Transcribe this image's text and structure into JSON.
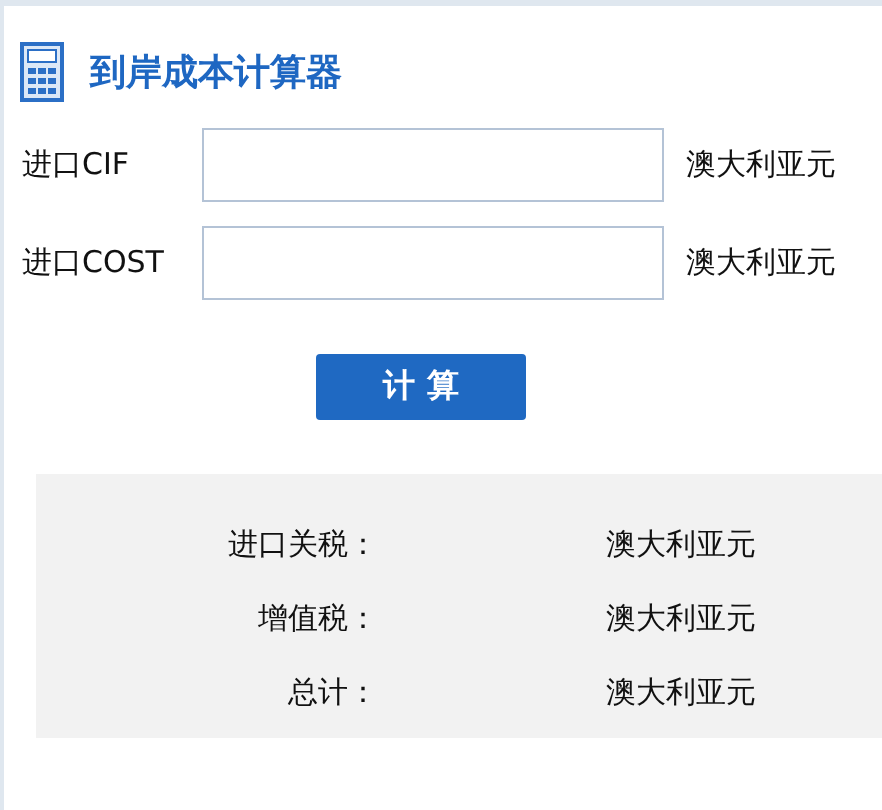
{
  "title": "到岸成本计算器",
  "fields": [
    {
      "label": "进口CIF",
      "unit": "澳大利亚元"
    },
    {
      "label": "进口COST",
      "unit": "澳大利亚元"
    }
  ],
  "button": "计 算",
  "results": [
    {
      "label": "进口关税：",
      "unit": "澳大利亚元"
    },
    {
      "label": "增值税：",
      "unit": "澳大利亚元"
    },
    {
      "label": "总计：",
      "unit": "澳大利亚元"
    }
  ]
}
